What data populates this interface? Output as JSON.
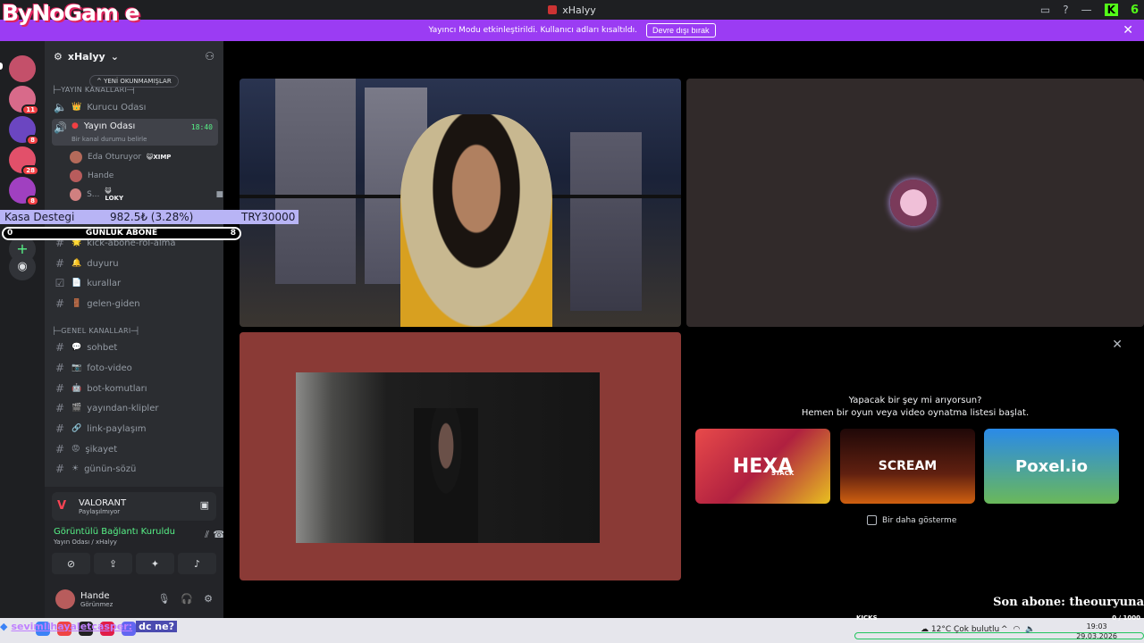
{
  "window": {
    "title": "xHalyy",
    "kick_num": "6"
  },
  "logo_text": "ByNoGam e",
  "notice": {
    "text": "Yayıncı Modu etkinleştirildi. Kullanıcı adları kısaltıldı.",
    "button": "Devre dışı bırak"
  },
  "rail": {
    "badges": [
      "11",
      "8",
      "28",
      "8"
    ]
  },
  "server": {
    "name": "xHalyy",
    "unread_pill": "YENİ OKUNMAMIŞLAR"
  },
  "categories": {
    "yayin": "YAYIN KANALLARI",
    "genel": "GENEL KANALLARI"
  },
  "voice_channels": {
    "kurucu": {
      "emoji": "👑",
      "name": "Kurucu Odası"
    },
    "yayin": {
      "name": "Yayın Odası",
      "time": "18:40",
      "status": "Bir kanal durumu belirle"
    }
  },
  "voice_users": [
    {
      "name": "Eda Oturuyor",
      "tag": "😺XIMP"
    },
    {
      "name": "Hande",
      "tag": ""
    },
    {
      "name": "S...",
      "tag": "😺LOKY"
    }
  ],
  "kasa": {
    "label": "Kasa Destegi",
    "amount": "982.5₺ (3.28%)",
    "goal": "TRY30000"
  },
  "abone": {
    "left": "0",
    "label": "GÜNLÜK ABONE",
    "right": "8"
  },
  "text_channels_top": [
    {
      "emoji": "🌟",
      "name": "kick-abone-rol-alma"
    },
    {
      "emoji": "🔔",
      "name": "duyuru"
    },
    {
      "emoji": "📄",
      "name": "kurallar"
    },
    {
      "emoji": "🚪",
      "name": "gelen-giden"
    }
  ],
  "text_channels_genel": [
    {
      "emoji": "💬",
      "name": "sohbet"
    },
    {
      "emoji": "📷",
      "name": "foto-video"
    },
    {
      "emoji": "🤖",
      "name": "bot-komutları"
    },
    {
      "emoji": "🎬",
      "name": "yayından-klipler"
    },
    {
      "emoji": "🔗",
      "name": "link-paylaşım"
    },
    {
      "emoji": "😡",
      "name": "şikayet"
    },
    {
      "emoji": "☀",
      "name": "günün-sözü"
    }
  ],
  "activity": {
    "title": "VALORANT",
    "sub": "Paylaşılmıyor"
  },
  "rtc": {
    "status": "Görüntülü Bağlantı Kuruldu",
    "sub": "Yayın Odası / xHalyy"
  },
  "user": {
    "name": "Hande",
    "status": "Görünmez"
  },
  "activity_panel": {
    "h1": "Yapacak bir şey mi arıyorsun?",
    "h2": "Hemen bir oyun veya video oynatma listesi başlat.",
    "games": [
      {
        "name": "HEXA",
        "sub": "STACK"
      },
      {
        "name": "SCREAM",
        "sub": ""
      },
      {
        "name": "Poxel.io",
        "sub": ""
      }
    ],
    "dont_show": "Bir daha gösterme"
  },
  "son_abone": "Son abone: theouryuna",
  "chat": {
    "user": "sevimlihayaletcasper:",
    "msg": "dc ne?"
  },
  "taskbar": {
    "kick_label": "KICKS",
    "kick_count": "0 / 1000",
    "weather": "12°C  Çok bulutlu",
    "time": "19:03",
    "date": "29.03.2026"
  },
  "colors": {
    "notice": "#9b3cf3",
    "online": "#57f287",
    "accent": "#53fc18"
  }
}
